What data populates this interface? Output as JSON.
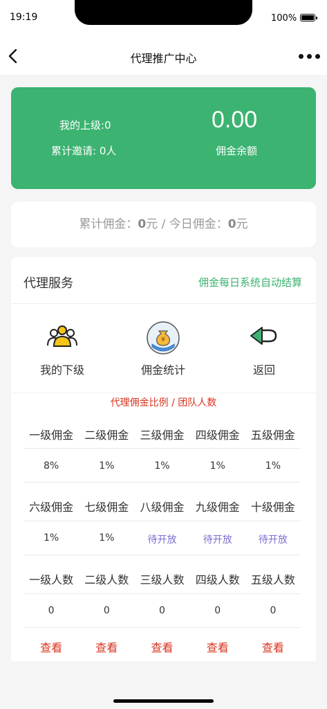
{
  "status_bar": {
    "time": "19:19",
    "battery": "100%"
  },
  "nav": {
    "title": "代理推广中心"
  },
  "summary_card": {
    "superior": "我的上级:0",
    "total_invites": "累计邀请: 0人",
    "balance": "0.00",
    "balance_label": "佣金余额"
  },
  "earnings": {
    "total_label": "累计佣金：",
    "total_value": "0",
    "unit": "元",
    "separator": " / ",
    "today_label": "今日佣金：",
    "today_value": "0"
  },
  "service": {
    "title": "代理服务",
    "note": "佣金每日系统自动结算",
    "items": [
      {
        "label": "我的下级",
        "icon": "users-icon"
      },
      {
        "label": "佣金统计",
        "icon": "money-bag-hand-icon"
      },
      {
        "label": "返回",
        "icon": "return-arrow-icon"
      }
    ]
  },
  "ratio_title": "代理佣金比例 / 团队人数",
  "commission_levels_1": [
    "一级佣金",
    "二级佣金",
    "三级佣金",
    "四级佣金",
    "五级佣金"
  ],
  "commission_rates_1": [
    "8%",
    "1%",
    "1%",
    "1%",
    "1%"
  ],
  "commission_levels_2": [
    "六级佣金",
    "七级佣金",
    "八级佣金",
    "九级佣金",
    "十级佣金"
  ],
  "commission_rates_2": [
    "1%",
    "1%",
    "待开放",
    "待开放",
    "待开放"
  ],
  "team_levels": [
    "一级人数",
    "二级人数",
    "三级人数",
    "四级人数",
    "五级人数"
  ],
  "team_counts": [
    "0",
    "0",
    "0",
    "0",
    "0"
  ],
  "view_label": [
    "查看",
    "查看",
    "查看",
    "查看",
    "查看"
  ],
  "colors": {
    "accent_green": "#3cb371",
    "link_red": "#d9341f",
    "pending_purple": "#7a6fd1"
  }
}
